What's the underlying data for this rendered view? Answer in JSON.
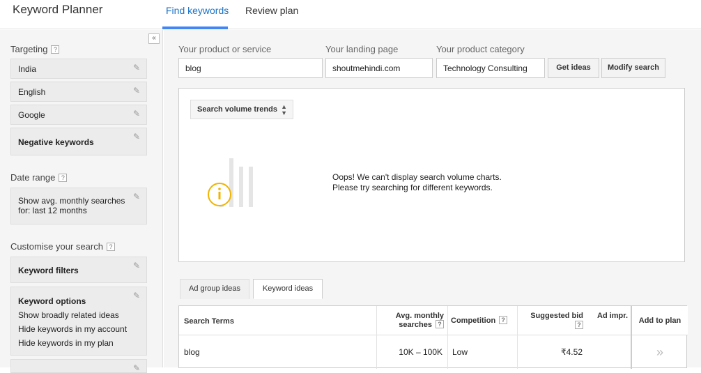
{
  "header": {
    "app_title": "Keyword Planner",
    "tabs": [
      {
        "label": "Find keywords",
        "active": true
      },
      {
        "label": "Review plan",
        "active": false
      }
    ]
  },
  "sidebar": {
    "collapse_symbol": "«",
    "targeting": {
      "label": "Targeting",
      "items": [
        {
          "label": "India"
        },
        {
          "label": "English"
        },
        {
          "label": "Google"
        },
        {
          "label": "Negative keywords"
        }
      ]
    },
    "date_range": {
      "label": "Date range",
      "line1": "Show avg. monthly searches",
      "line2": "for: last 12 months"
    },
    "customise": {
      "label": "Customise your search",
      "keyword_filters": "Keyword filters",
      "keyword_options": {
        "title": "Keyword options",
        "lines": [
          "Show broadly related ideas",
          "Hide keywords in my account",
          "Hide keywords in my plan"
        ]
      }
    },
    "help_glyph": "?"
  },
  "search": {
    "product_label": "Your product or service",
    "product_value": "blog",
    "landing_label": "Your landing page",
    "landing_value": "shoutmehindi.com",
    "category_label": "Your product category",
    "category_value": "Technology Consulting",
    "get_ideas": "Get ideas",
    "modify_search": "Modify search"
  },
  "chart_panel": {
    "select_label": "Search volume trends",
    "message_line1": "Oops! We can't display search volume charts.",
    "message_line2": "Please try searching for different keywords.",
    "icon": "info-bar-chart-icon"
  },
  "result_tabs": [
    {
      "label": "Ad group ideas",
      "active": false
    },
    {
      "label": "Keyword ideas",
      "active": true
    }
  ],
  "table": {
    "headers": {
      "search_terms": "Search Terms",
      "avg_line1": "Avg. monthly",
      "avg_line2": "searches",
      "competition": "Competition",
      "bid": "Suggested bid",
      "ad_impr": "Ad impr.",
      "add_to_plan": "Add to plan"
    },
    "rows": [
      {
        "term": "blog",
        "avg": "10K – 100K",
        "competition": "Low",
        "bid": "₹4.52",
        "add": "»"
      }
    ]
  },
  "colors": {
    "accent": "#4285f4",
    "info_icon": "#f0b400"
  }
}
